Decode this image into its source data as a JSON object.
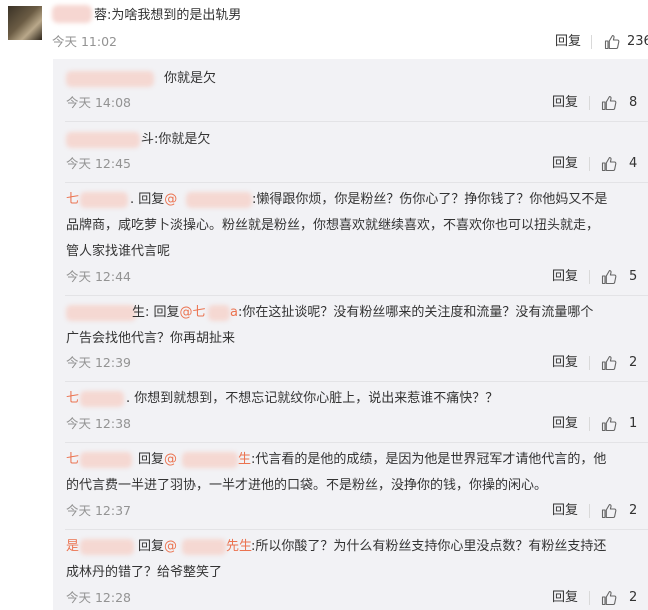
{
  "main_comment": {
    "name_tail": "蓉",
    "text": ":为啥我想到的是出轨男",
    "time": "今天 11:02",
    "reply_label": "回复",
    "likes": "236"
  },
  "replies": [
    {
      "lead": "",
      "mention_prefix": "",
      "text": "你就是欠",
      "time": "今天 14:08",
      "reply_label": "回复",
      "likes": "8"
    },
    {
      "lead": "",
      "mention_prefix": "",
      "text": "斗:你就是欠",
      "time": "今天 12:45",
      "reply_label": "回复",
      "likes": "4"
    },
    {
      "lead": "七",
      "line1_pre": ". 回复",
      "mention_at": "@",
      "line1_post": ":懒得跟你烦，你是粉丝？伤你心了？挣你钱了？你他妈又不是",
      "line2": "品牌商，咸吃萝卜淡操心。粉丝就是粉丝，你想喜欢就继续喜欢，不喜欢你也可以扭头就走，",
      "line3": "管人家找谁代言呢",
      "time": "今天 12:44",
      "reply_label": "回复",
      "likes": "5"
    },
    {
      "lead": "",
      "line1_pre": "生: 回复",
      "mention_at": "@七",
      "mention_tail": "a",
      "line1_post": ":你在这扯谈呢？没有粉丝哪来的关注度和流量？没有流量哪个",
      "line2": "广告会找他代言？你再胡扯来",
      "time": "今天 12:39",
      "reply_label": "回复",
      "likes": "2"
    },
    {
      "lead": "七",
      "line1_post": ". 你想到就想到，不想忘记就纹你心脏上，说出来惹谁不痛快？？",
      "time": "今天 12:38",
      "reply_label": "回复",
      "likes": "1"
    },
    {
      "lead": "七",
      "line1_pre": "回复",
      "mention_at": "@",
      "mention_tail": "生",
      "line1_post": ":代言看的是他的成绩，是因为他是世界冠军才请他代言的，他",
      "line2": "的代言费一半进了羽协，一半才进他的口袋。不是粉丝，没挣你的钱，你操的闲心。",
      "time": "今天 12:37",
      "reply_label": "回复",
      "likes": "2"
    },
    {
      "lead": "是",
      "line1_pre": "回复",
      "mention_at": "@",
      "mention_tail": "先生",
      "line1_post": ":所以你酸了？为什么有粉丝支持你心里没点数？有粉丝支持还",
      "line2": "成林丹的错了？给爷整笑了",
      "time": "今天 12:28",
      "reply_label": "回复",
      "likes": "2"
    }
  ],
  "icons": {
    "like": "thumbs-up-icon"
  },
  "colors": {
    "mention": "#eb7350",
    "reply_bg": "#f2f2f5",
    "meta": "#939393"
  }
}
